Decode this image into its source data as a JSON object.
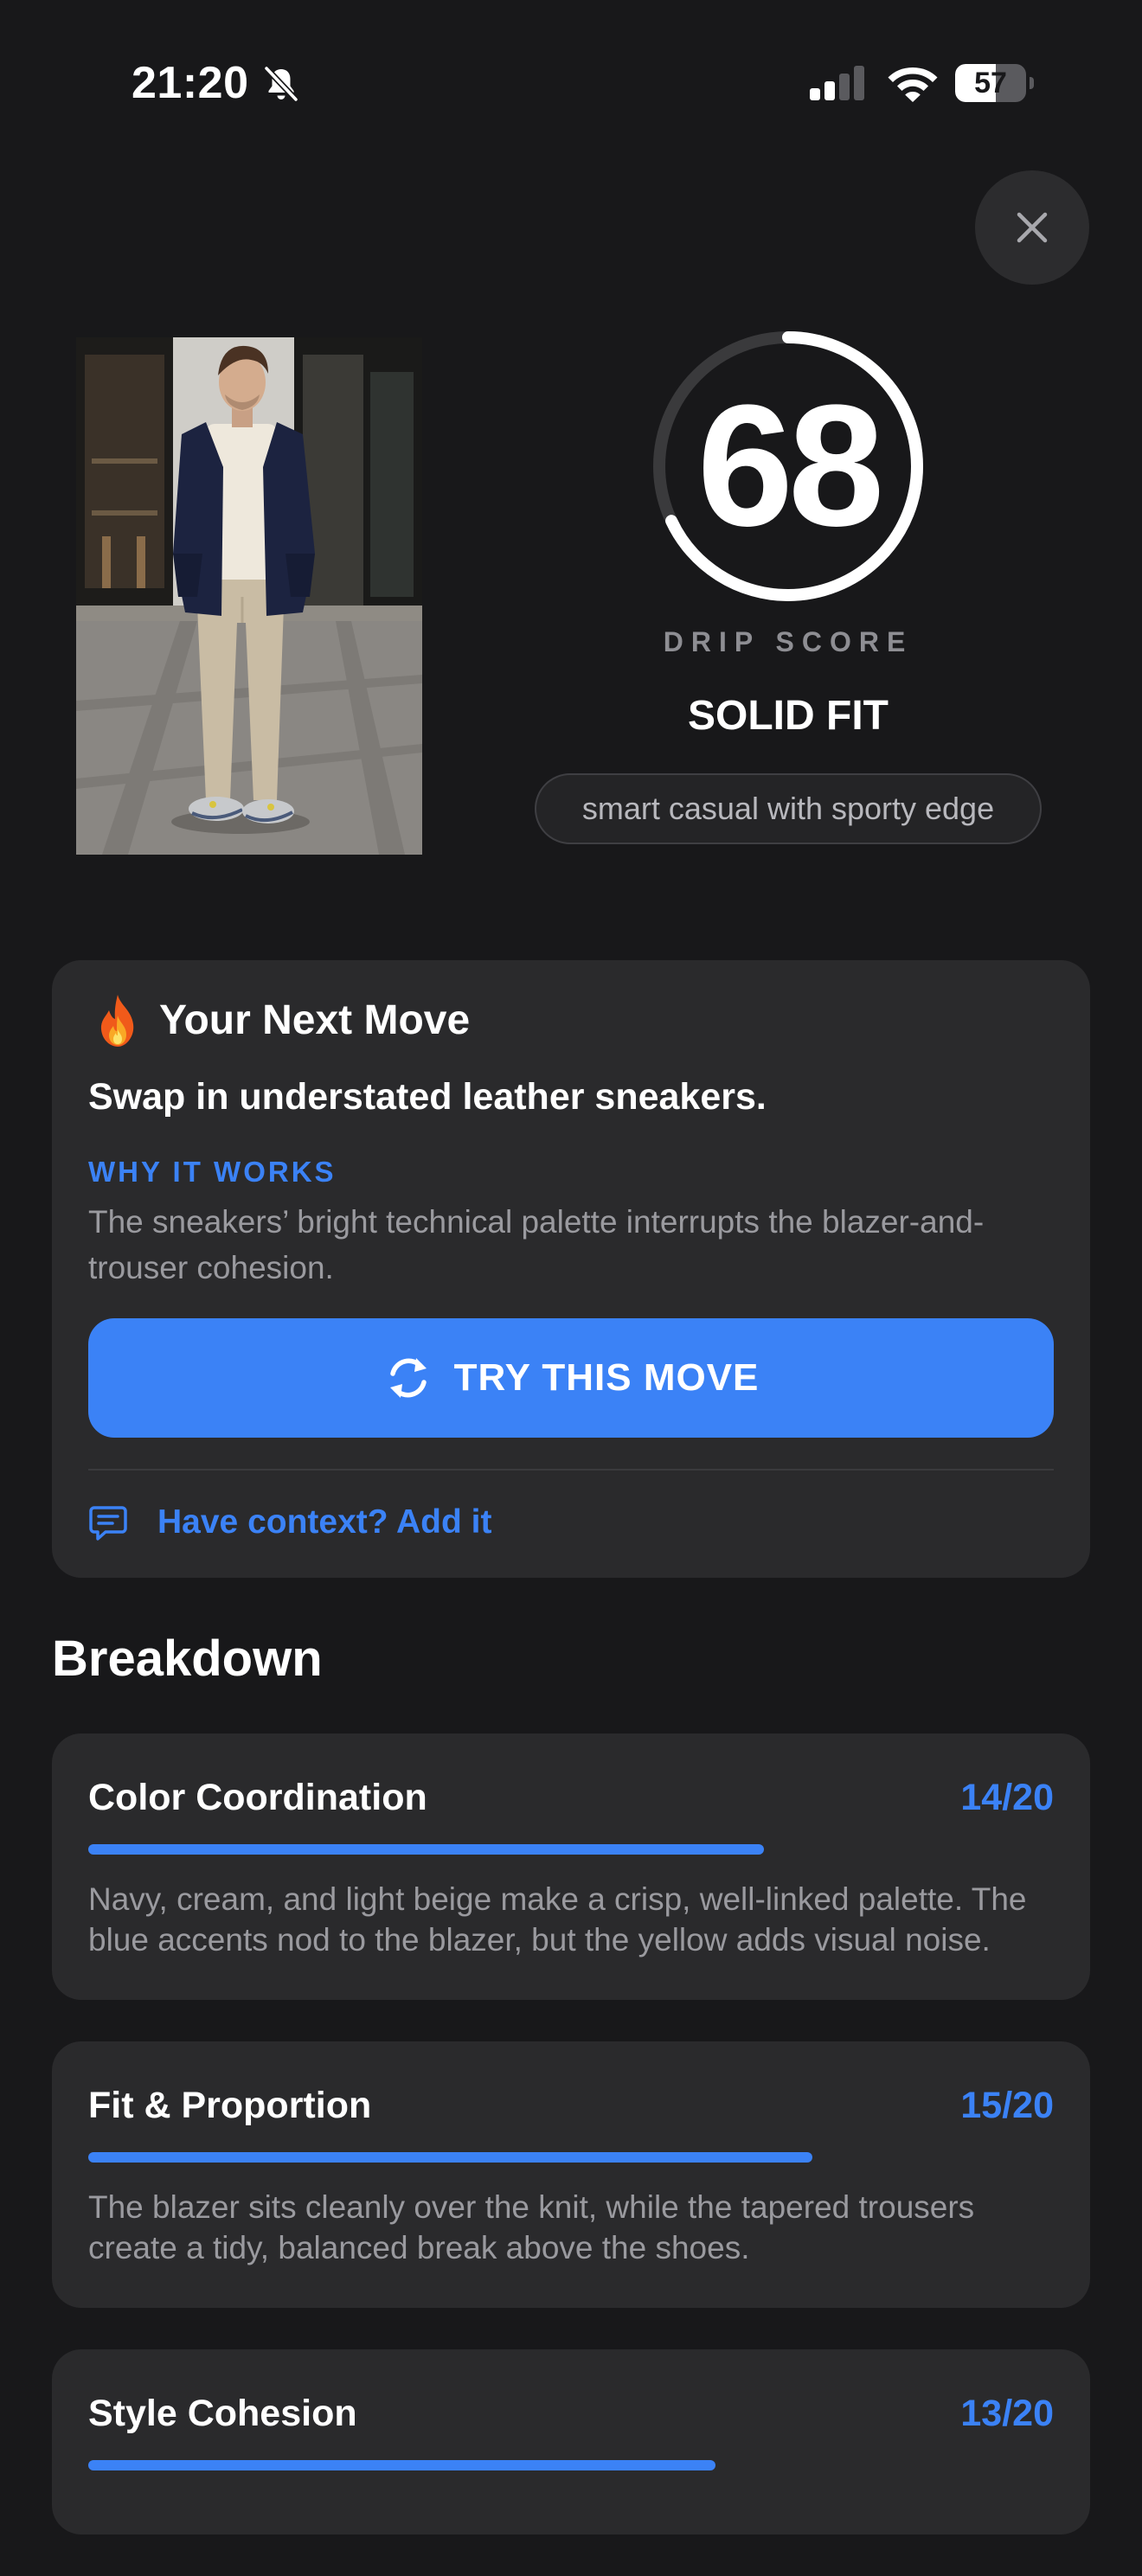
{
  "status_bar": {
    "time": "21:20",
    "battery": "57",
    "battery_level": 0.57,
    "icons": [
      "bell-slash-icon",
      "signal-icon",
      "wifi-icon",
      "battery-icon"
    ]
  },
  "header": {
    "close_icon": "close-icon"
  },
  "score": {
    "value": "68",
    "max": 100,
    "label": "DRIP SCORE",
    "verdict": "SOLID FIT",
    "style_tag": "smart casual with sporty edge"
  },
  "next_move": {
    "icon": "fire-icon",
    "title": "Your Next Move",
    "suggestion": "Swap in understated leather sneakers.",
    "why_label": "WHY IT WORKS",
    "why_text": "The sneakers’ bright technical palette interrupts the blazer-and-trouser cohesion.",
    "button_label": "TRY THIS MOVE",
    "button_icon": "refresh-icon",
    "context_label": "Have context? Add it",
    "context_icon": "comment-icon"
  },
  "breakdown": {
    "heading": "Breakdown",
    "items": [
      {
        "title": "Color Coordination",
        "score": "14/20",
        "value": 14,
        "max": 20,
        "description": "Navy, cream, and light beige make a crisp, well-linked palette. The blue accents nod to the blazer, but the yellow adds visual noise."
      },
      {
        "title": "Fit & Proportion",
        "score": "15/20",
        "value": 15,
        "max": 20,
        "description": "The blazer sits cleanly over the knit, while the tapered trousers create a tidy, balanced break above the shoes."
      },
      {
        "title": "Style Cohesion",
        "score": "13/20",
        "value": 13,
        "max": 20,
        "description": ""
      }
    ]
  },
  "colors": {
    "background": "#18181a",
    "card": "#2a2a2c",
    "accent": "#3b82f6",
    "muted_text": "#9a9a9f",
    "ring_track": "#3a3a3c"
  }
}
